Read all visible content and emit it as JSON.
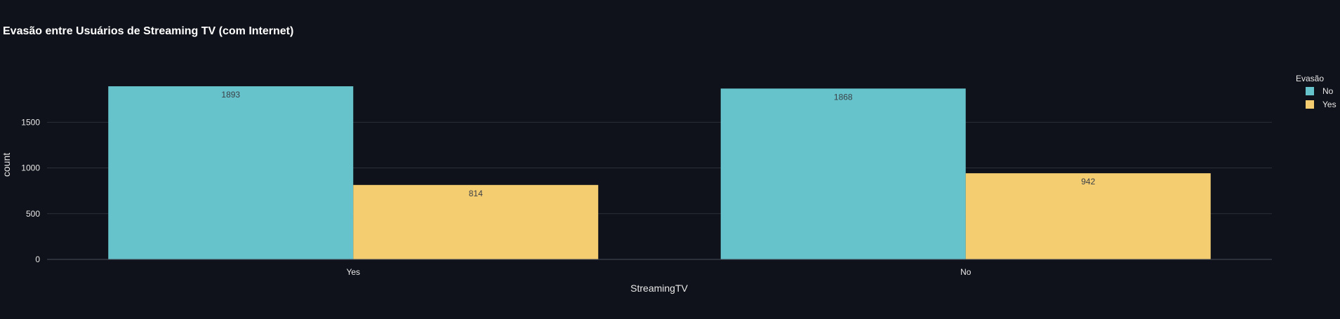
{
  "colors": {
    "background": "#0f121a",
    "grid": "#2b2f38",
    "axis_line": "#4a4f5a",
    "text": "#e8e8e8",
    "data_label": "#3b3f46",
    "no": "#66c3cb",
    "yes": "#f4cd71"
  },
  "chart_data": {
    "type": "bar",
    "title": "Evasão entre Usuários de Streaming TV (com Internet)",
    "xlabel": "StreamingTV",
    "ylabel": "count",
    "categories": [
      "Yes",
      "No"
    ],
    "series": [
      {
        "name": "No",
        "values": [
          1893,
          1868
        ],
        "color": "#66c3cb"
      },
      {
        "name": "Yes",
        "values": [
          814,
          942
        ],
        "color": "#f4cd71"
      }
    ],
    "yticks": [
      0,
      500,
      1000,
      1500
    ],
    "ylim": [
      0,
      1993
    ],
    "grid": true,
    "legend": {
      "title": "Evasão",
      "placement": "right"
    },
    "barmode": "group"
  }
}
